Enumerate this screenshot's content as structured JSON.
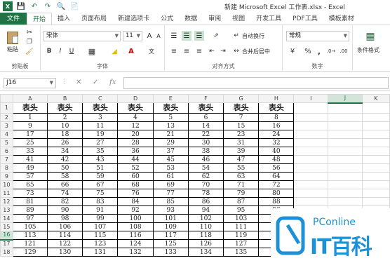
{
  "window": {
    "title": "新建 Microsoft Excel 工作表.xlsx - Excel"
  },
  "qat": {
    "icons": [
      "excel-icon",
      "save-icon",
      "undo-icon",
      "redo-icon",
      "preview-icon",
      "new-icon"
    ]
  },
  "tabs": [
    "文件",
    "开始",
    "插入",
    "页面布局",
    "新建选项卡",
    "公式",
    "数据",
    "审阅",
    "视图",
    "开发工具",
    "PDF工具",
    "模板素材"
  ],
  "ribbon": {
    "clipboard": {
      "label": "剪贴板",
      "paste": "粘贴"
    },
    "font": {
      "label": "字体",
      "font_name": "宋体",
      "font_size": "11",
      "bold": "B",
      "italic": "I",
      "underline": "U",
      "grow": "A",
      "shrink": "A"
    },
    "alignment": {
      "label": "对齐方式",
      "wrap": "自动换行",
      "merge": "合并后居中"
    },
    "number": {
      "label": "数字",
      "format": "常规",
      "percent": "%",
      "comma": ","
    },
    "styles": {
      "conditional": "条件格式"
    }
  },
  "formula_bar": {
    "name_box": "J16",
    "fx": "fx",
    "value": ""
  },
  "columns": [
    "A",
    "B",
    "C",
    "D",
    "E",
    "F",
    "G",
    "H",
    "I",
    "J",
    "K"
  ],
  "header_text": "表头",
  "rows": [
    [
      "1",
      "2",
      "3",
      "4",
      "5",
      "6",
      "7",
      "8"
    ],
    [
      "9",
      "10",
      "11",
      "12",
      "13",
      "14",
      "15",
      "16"
    ],
    [
      "17",
      "18",
      "19",
      "20",
      "21",
      "22",
      "23",
      "24"
    ],
    [
      "25",
      "26",
      "27",
      "28",
      "29",
      "30",
      "31",
      "32"
    ],
    [
      "33",
      "34",
      "35",
      "36",
      "37",
      "38",
      "39",
      "40"
    ],
    [
      "41",
      "42",
      "43",
      "44",
      "45",
      "46",
      "47",
      "48"
    ],
    [
      "49",
      "50",
      "51",
      "52",
      "53",
      "54",
      "55",
      "56"
    ],
    [
      "57",
      "58",
      "59",
      "60",
      "61",
      "62",
      "63",
      "64"
    ],
    [
      "65",
      "66",
      "67",
      "68",
      "69",
      "70",
      "71",
      "72"
    ],
    [
      "73",
      "74",
      "75",
      "76",
      "77",
      "78",
      "79",
      "80"
    ],
    [
      "81",
      "82",
      "83",
      "84",
      "85",
      "86",
      "87",
      "88"
    ],
    [
      "89",
      "90",
      "91",
      "92",
      "93",
      "94",
      "95",
      "96"
    ],
    [
      "97",
      "98",
      "99",
      "100",
      "101",
      "102",
      "103",
      "104"
    ],
    [
      "105",
      "106",
      "107",
      "108",
      "109",
      "110",
      "111",
      "112"
    ],
    [
      "113",
      "114",
      "115",
      "116",
      "117",
      "118",
      "119",
      "120"
    ],
    [
      "121",
      "122",
      "123",
      "124",
      "125",
      "126",
      "127",
      "128"
    ],
    [
      "129",
      "130",
      "131",
      "132",
      "133",
      "134",
      "135",
      "136"
    ]
  ],
  "row_numbers": [
    "1",
    "2",
    "3",
    "4",
    "5",
    "6",
    "7",
    "8",
    "9",
    "10",
    "11",
    "12",
    "13",
    "14",
    "15",
    "16",
    "17",
    "18"
  ],
  "selected_cell": "J16",
  "watermark": {
    "line1": "PConline",
    "line2": "IT百科"
  },
  "colors": {
    "accent": "#217346",
    "watermark": "#1e90d6"
  }
}
